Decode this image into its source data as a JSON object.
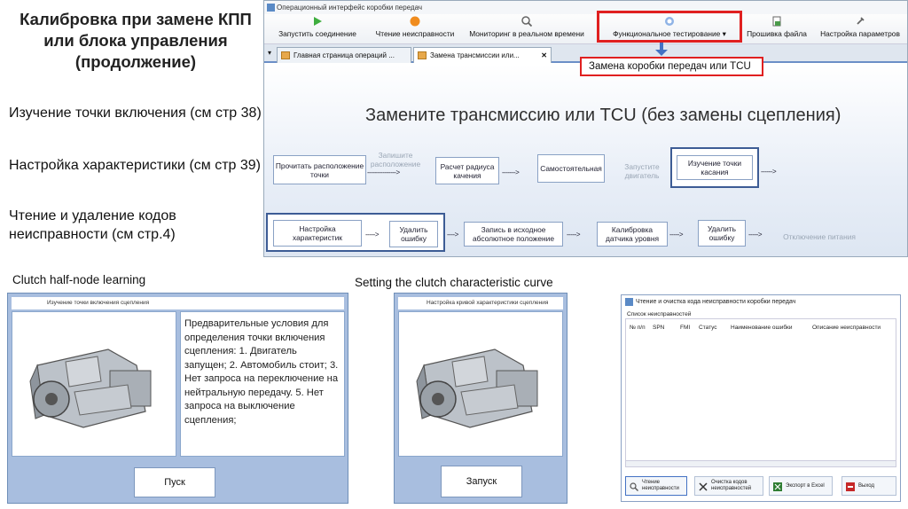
{
  "slide": {
    "title": "Калибровка при замене КПП или блока управления (продолжение)",
    "items": [
      "Изучение точки включения (см стр 38)",
      "Настройка характеристики (см стр 39)",
      "Чтение и удаление кодов неисправности (см стр.4)"
    ],
    "caption_left": "Clutch half-node learning",
    "caption_middle": "Setting the clutch characteristic curve"
  },
  "app": {
    "window_title": "Операционный интерфейс коробки передач",
    "toolbar": [
      {
        "label": "Запустить соединение",
        "icon": "play-icon"
      },
      {
        "label": "Чтение неисправности",
        "icon": "circle-icon"
      },
      {
        "label": "Мониторинг в реальном времени",
        "icon": "monitor-icon"
      },
      {
        "label": "Функциональное тестирование",
        "icon": "test-icon"
      },
      {
        "label": "Прошивка файла",
        "icon": "file-icon"
      },
      {
        "label": "Настройка параметров",
        "icon": "settings-icon"
      }
    ],
    "callout": "Замена коробки передач или TCU",
    "tabs": [
      {
        "label": "Главная страница операций ...",
        "active": false
      },
      {
        "label": "Замена трансмиссии или...",
        "active": true
      }
    ],
    "heading": "Замените трансмиссию или TCU (без замены сцепления)",
    "flow_row1": {
      "box1": "Прочитать расположение точки",
      "label1": "Запишите расположение",
      "box2": "Расчет радиуса качения",
      "box3": "Самостоятельная",
      "label2": "Запустите двигатель",
      "box4": "Изучение точки касания"
    },
    "flow_row2": {
      "box1": "Настройка характеристик",
      "box2": "Удалить ошибку",
      "box3": "Запись в исходное абсолютное положение",
      "box4": "Калибровка датчика уровня",
      "box5": "Удалить ошибку",
      "label1": "Отключение питания"
    }
  },
  "dialog_left": {
    "title": "Изучение точки включения сцепления",
    "preconditions": "Предварительные условия для определения точки включения сцепления: 1. Двигатель запущен; 2. Автомобиль стоит; 3. Нет запроса на переключение на нейтральную передачу. 5. Нет запроса на выключение сцепления;",
    "button": "Пуск"
  },
  "dialog_middle": {
    "title": "Настройка кривой характеристики сцепления",
    "button": "Запуск"
  },
  "fault_window": {
    "title": "Чтение и очистка  кода неисправности коробки передач",
    "list_label": "Список неисправностей",
    "columns": [
      "№ п/п",
      "SPN",
      "FMI",
      "Статус",
      "Наименование ошибки",
      "Описание неисправности"
    ],
    "buttons": [
      {
        "label": "Чтение неисправности",
        "icon": "read-icon"
      },
      {
        "label": "Очистка кодов неисправностей",
        "icon": "clear-icon"
      },
      {
        "label": "Экспорт в Excel",
        "icon": "excel-icon"
      },
      {
        "label": "Выход",
        "icon": "exit-icon"
      }
    ]
  },
  "colors": {
    "accent": "#e02020",
    "highlight_border": "#3d5c95",
    "dialog_bg": "#a8bedf"
  }
}
